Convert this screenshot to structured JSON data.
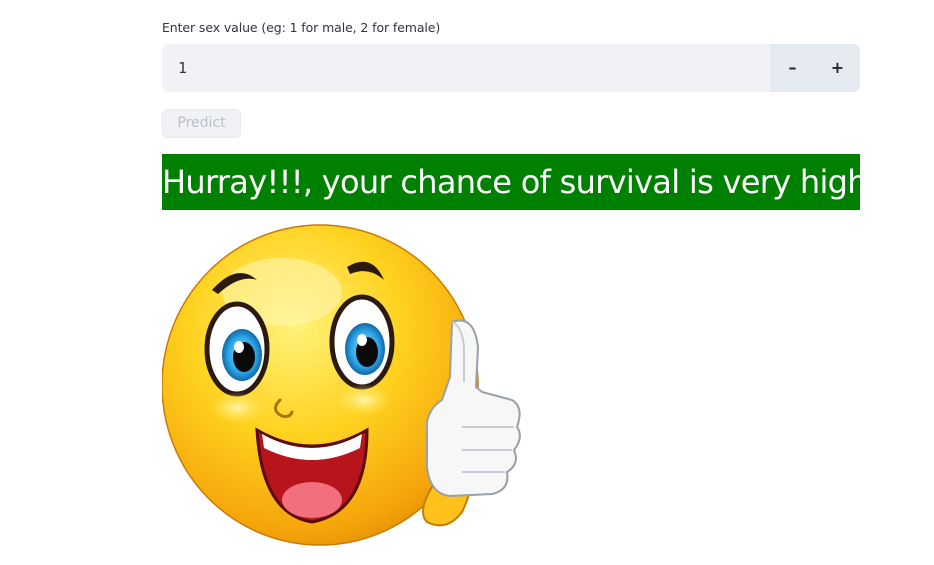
{
  "form": {
    "sex_field": {
      "label": "Enter sex value (eg: 1 for male, 2 for female)",
      "value": "1",
      "decrement_label": "–",
      "increment_label": "+"
    },
    "predict_button": {
      "label": "Predict",
      "state": "disabled"
    }
  },
  "result": {
    "message": "Hurray!!!, your chance of survival is very high",
    "background_color": "#008000",
    "text_color": "#ffffff",
    "image": "smiling-emoji-thumbs-up"
  }
}
